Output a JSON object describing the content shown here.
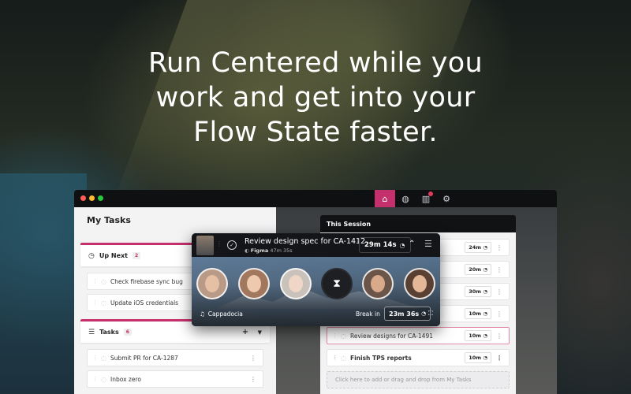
{
  "headline": {
    "line1": "Run Centered while you",
    "line2": "work and get into your",
    "line3": "Flow State faster."
  },
  "nav": {
    "home_icon": "home-icon",
    "globe_icon": "globe-icon",
    "stats_icon": "bar-chart-icon",
    "settings_icon": "gear-icon",
    "accent": "#c4306b"
  },
  "left": {
    "title": "My Tasks",
    "up_next": {
      "label": "Up Next",
      "count": "2"
    },
    "up_next_tasks": [
      "Check firebase sync bug",
      "Update iOS credentials"
    ],
    "tasks": {
      "label": "Tasks",
      "count": "6"
    },
    "task_items": [
      "Submit PR for CA-1287",
      "Inbox zero"
    ]
  },
  "session": {
    "title": "This Session",
    "items": [
      {
        "label": "",
        "duration": "24m"
      },
      {
        "label": "",
        "duration": "20m"
      },
      {
        "label": "",
        "duration": "30m"
      },
      {
        "label": "",
        "duration": "10m"
      },
      {
        "label": "Review designs for CA-1491",
        "duration": "10m"
      },
      {
        "label": "Finish TPS reports",
        "duration": "10m"
      }
    ],
    "dropzone": "Click here to add or drag and drop from My Tasks"
  },
  "overlay": {
    "title": "Review design spec for CA-1412",
    "app": "Figma",
    "elapsed": "47m 35s",
    "timer": "29m 14s",
    "music": "Cappadocia",
    "break_label": "Break in",
    "break_timer": "23m 36s"
  }
}
